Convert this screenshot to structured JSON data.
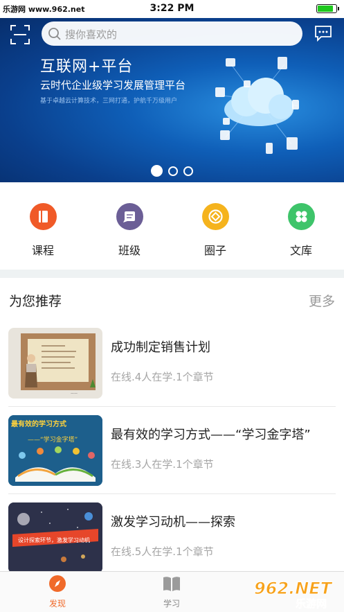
{
  "status_bar": {
    "watermark": "乐游网 www.962.net",
    "time": "3:22 PM",
    "battery_level": 0.9
  },
  "header": {
    "search_placeholder": "搜你喜欢的"
  },
  "banner": {
    "title": "互联网+平台",
    "subtitle": "云时代企业级学习发展管理平台",
    "tagline": "基于卓越云计算技术，三网打通，护航千万级用户",
    "page_count": 3,
    "active_index": 0
  },
  "quick_nav": [
    {
      "label": "课程",
      "color": "#f05a28",
      "icon": "book-icon"
    },
    {
      "label": "班级",
      "color": "#6b5e96",
      "icon": "message-icon"
    },
    {
      "label": "圈子",
      "color": "#f5b31d",
      "icon": "circle-icon"
    },
    {
      "label": "文库",
      "color": "#3ec46a",
      "icon": "clover-icon"
    }
  ],
  "recommend": {
    "title": "为您推荐",
    "more": "更多",
    "courses": [
      {
        "title": "成功制定销售计划",
        "meta": "在线.4人在学.1个章节"
      },
      {
        "title": "最有效的学习方式——“学习金字塔”",
        "meta": "在线.3人在学.1个章节",
        "thumb_text_top": "最有效的学习方式",
        "thumb_text_mid": "——“学习金字塔”"
      },
      {
        "title": "激发学习动机——探索",
        "meta": "在线.5人在学.1个章节",
        "thumb_text": "设计探索环节，激发学习动机"
      }
    ]
  },
  "tabbar": {
    "tabs": [
      {
        "label": "发现",
        "icon": "compass-icon",
        "active": true
      },
      {
        "label": "学习",
        "icon": "open-book-icon",
        "active": false
      }
    ]
  },
  "watermark_br": {
    "brand": "962.NET",
    "sub": "乐游网"
  },
  "colors": {
    "accent": "#f06a2a",
    "banner_blue": "#0f5fb8"
  }
}
